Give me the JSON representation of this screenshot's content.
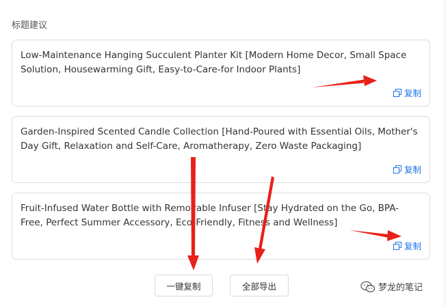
{
  "section": {
    "label": "标题建议"
  },
  "suggestions": [
    {
      "text": "Low-Maintenance Hanging Succulent Planter Kit [Modern Home Decor, Small Space Solution, Housewarming Gift, Easy-to-Care-for Indoor Plants]",
      "copy_label": "复制"
    },
    {
      "text": "Garden-Inspired Scented Candle Collection [Hand-Poured with Essential Oils, Mother's Day Gift, Relaxation and Self-Care, Aromatherapy, Zero Waste Packaging]",
      "copy_label": "复制"
    },
    {
      "text": "Fruit-Infused Water Bottle with Removable Infuser [Stay Hydrated on the Go, BPA-Free, Perfect Summer Accessory, Eco-Friendly, Fitness and Wellness]",
      "copy_label": "复制"
    }
  ],
  "actions": {
    "copy_all_label": "一键复制",
    "export_all_label": "全部导出"
  },
  "watermark": {
    "text": "梦龙的笔记",
    "icon": "wechat-icon"
  },
  "colors": {
    "accent": "#1a73e8",
    "annotation_arrow": "#e8201a",
    "border": "#dcdcdc"
  }
}
